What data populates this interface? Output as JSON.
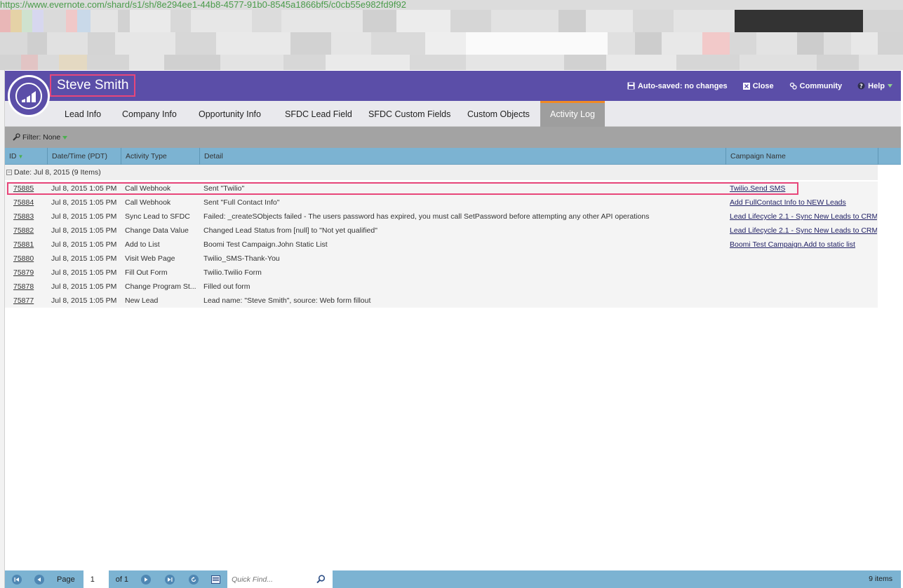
{
  "browser": {
    "url_text": "https://www.evernote.com/shard/s1/sh/8e294ee1-44b8-4577-91b0-8545a1866bf5/c0cb55e982fd9f92"
  },
  "header": {
    "title": "Steve Smith",
    "autosave_label": "Auto-saved: no changes",
    "close_label": "Close",
    "community_label": "Community",
    "help_label": "Help",
    "accent_color": "#5b4ea8",
    "highlight_color": "#e8467a"
  },
  "tabs": [
    {
      "label": "Lead Info",
      "active": false
    },
    {
      "label": "Company Info",
      "active": false
    },
    {
      "label": "Opportunity Info",
      "active": false
    },
    {
      "label": "SFDC Lead Field",
      "active": false
    },
    {
      "label": "SFDC Custom Fields",
      "active": false
    },
    {
      "label": "Custom Objects",
      "active": false
    },
    {
      "label": "Activity Log",
      "active": true
    }
  ],
  "filter": {
    "label": "Filter: None"
  },
  "grid": {
    "columns": [
      "ID",
      "Date/Time (PDT)",
      "Activity Type",
      "Detail",
      "Campaign Name"
    ],
    "group_label": "Date: Jul 8, 2015 (9 Items)",
    "rows": [
      {
        "id": "75885",
        "date": "Jul 8, 2015 1:05 PM",
        "type": "Call Webhook",
        "detail": "Sent \"Twilio\"",
        "campaign": "Twilio.Send SMS"
      },
      {
        "id": "75884",
        "date": "Jul 8, 2015 1:05 PM",
        "type": "Call Webhook",
        "detail": "Sent \"Full Contact Info\"",
        "campaign": "Add FullContact Info to NEW Leads"
      },
      {
        "id": "75883",
        "date": "Jul 8, 2015 1:05 PM",
        "type": "Sync Lead to SFDC",
        "detail": "Failed: _createSObjects failed - The users password has expired, you must call SetPassword before attempting any other API operations",
        "campaign": "Lead Lifecycle 2.1 - Sync New Leads to CRM"
      },
      {
        "id": "75882",
        "date": "Jul 8, 2015 1:05 PM",
        "type": "Change Data Value",
        "detail": "Changed Lead Status from [null] to \"Not yet qualified\"",
        "campaign": "Lead Lifecycle 2.1 - Sync New Leads to CRM"
      },
      {
        "id": "75881",
        "date": "Jul 8, 2015 1:05 PM",
        "type": "Add to List",
        "detail": "Boomi Test Campaign.John Static List",
        "campaign": "Boomi Test Campaign.Add to static list"
      },
      {
        "id": "75880",
        "date": "Jul 8, 2015 1:05 PM",
        "type": "Visit Web Page",
        "detail": "Twilio_SMS-Thank-You",
        "campaign": ""
      },
      {
        "id": "75879",
        "date": "Jul 8, 2015 1:05 PM",
        "type": "Fill Out Form",
        "detail": "Twilio.Twilio Form",
        "campaign": ""
      },
      {
        "id": "75878",
        "date": "Jul 8, 2015 1:05 PM",
        "type": "Change Program St...",
        "detail": "Filled out form",
        "campaign": ""
      },
      {
        "id": "75877",
        "date": "Jul 8, 2015 1:05 PM",
        "type": "New Lead",
        "detail": "Lead name: \"Steve Smith\", source: Web form fillout",
        "campaign": ""
      }
    ]
  },
  "footer": {
    "page_label": "Page",
    "page_value": "1",
    "of_label": "of 1",
    "quick_find_placeholder": "Quick Find...",
    "items_count": "9 items"
  }
}
